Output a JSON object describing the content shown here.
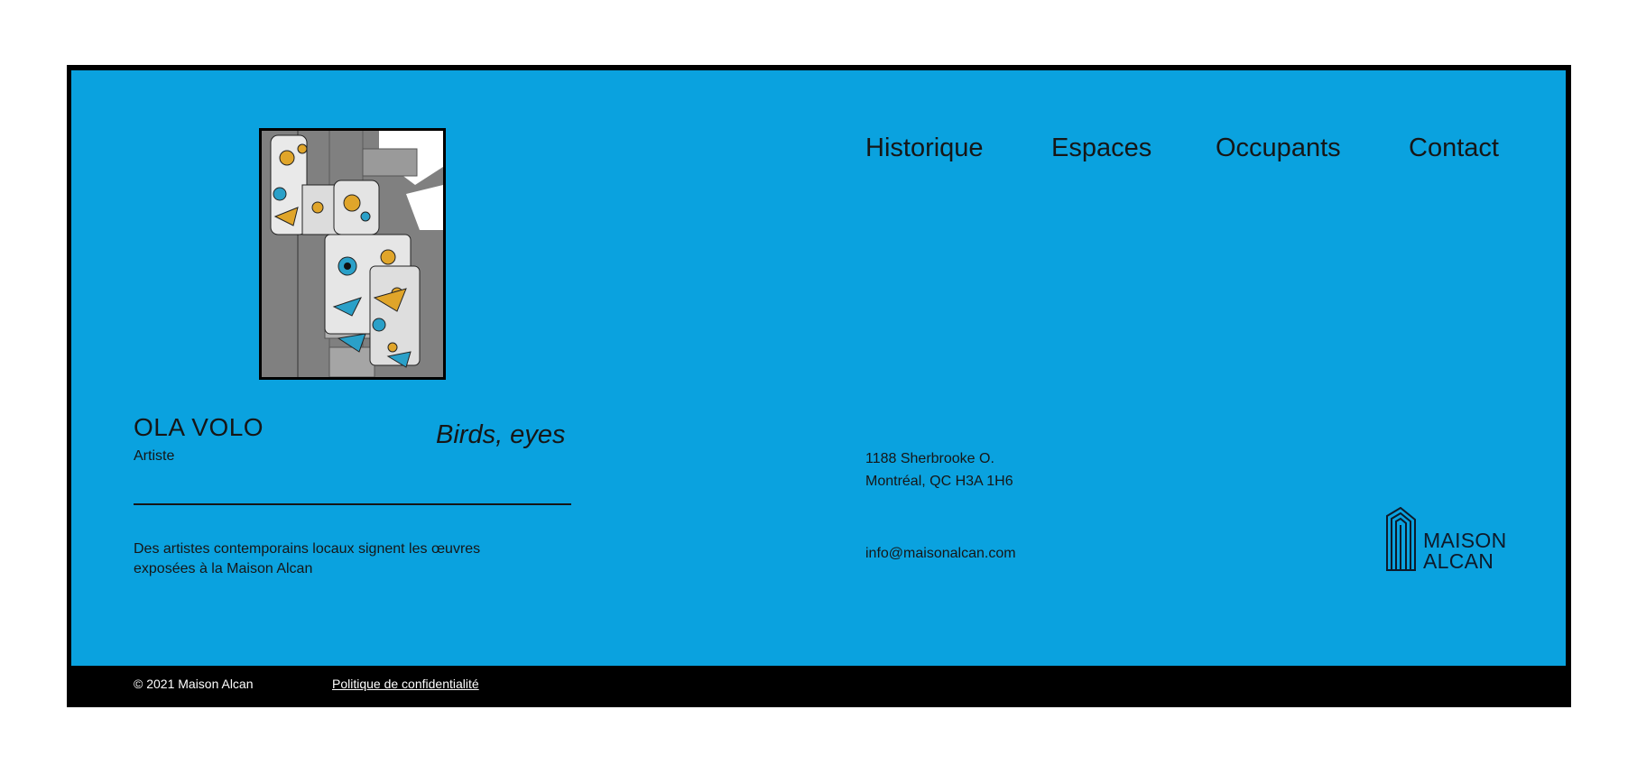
{
  "colors": {
    "background": "#0aa2df",
    "frame": "#000000",
    "text": "#161616",
    "footer_text": "#ffffff"
  },
  "nav": {
    "items": [
      {
        "label": "Historique"
      },
      {
        "label": "Espaces"
      },
      {
        "label": "Occupants"
      },
      {
        "label": "Contact"
      }
    ]
  },
  "artwork": {
    "image_icon": "mural-artwork-image"
  },
  "artist": {
    "name": "OLA VOLO",
    "role": "Artiste",
    "work_title": "Birds, eyes"
  },
  "description": "Des artistes contemporains locaux signent les œuvres exposées à la Maison Alcan",
  "contact": {
    "address_line1": "1188 Sherbrooke O.",
    "address_line2": "Montréal, QC H3A 1H6",
    "email": "info@maisonalcan.com"
  },
  "logo": {
    "line1": "MAISON",
    "line2": "ALCAN",
    "icon": "building-logo-icon"
  },
  "footer": {
    "copyright": "© 2021 Maison Alcan",
    "privacy_link": "Politique de confidentialité"
  }
}
